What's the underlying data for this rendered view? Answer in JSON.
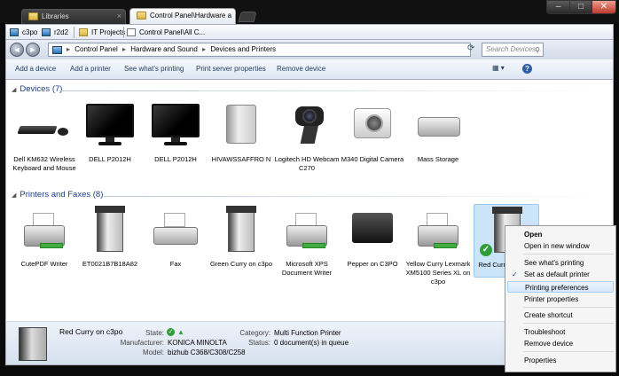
{
  "tabs": [
    {
      "label": "Libraries"
    },
    {
      "label": "Control Panel\\Hardware a"
    }
  ],
  "bookmarks": [
    {
      "label": "c3po",
      "icon": "computer-icon"
    },
    {
      "label": "r2d2",
      "icon": "computer-icon"
    },
    {
      "label": "IT Projects",
      "icon": "folder-icon"
    },
    {
      "label": "Control Panel\\All C...",
      "icon": "document-icon"
    }
  ],
  "address": {
    "crumbs": [
      "Control Panel",
      "Hardware and Sound",
      "Devices and Printers"
    ],
    "search_placeholder": "Search Devices..."
  },
  "commands": [
    "Add a device",
    "Add a printer",
    "See what's printing",
    "Print server properties",
    "Remove device"
  ],
  "groups": {
    "devices": {
      "label": "Devices (7)",
      "items": [
        "Dell KM632 Wireless Keyboard and Mouse",
        "DELL P2012H",
        "DELL P2012H",
        "HIVAWSSAFFRO N",
        "Logitech HD Webcam C270",
        "M340 Digital Camera",
        "Mass Storage"
      ]
    },
    "printers": {
      "label": "Printers and Faxes (8)",
      "items": [
        "CutePDF Writer",
        "ET0021B7B18A82",
        "Fax",
        "Green Curry on c3po",
        "Microsoft XPS Document Writer",
        "Pepper on C3PO",
        "Yellow Curry Lexmark XM5100 Series XL on c3po",
        "Red Curry on c3po"
      ]
    }
  },
  "details": {
    "name": "Red Curry on c3po",
    "state_label": "State:",
    "manufacturer_label": "Manufacturer:",
    "manufacturer": "KONICA MINOLTA",
    "model_label": "Model:",
    "model": "bizhub C368/C308/C258",
    "category_label": "Category:",
    "category": "Multi Function Printer",
    "status_label": "Status:",
    "status": "0 document(s) in queue"
  },
  "context_menu": [
    {
      "label": "Open",
      "bold": true
    },
    {
      "label": "Open in new window"
    },
    {
      "label": "See what's printing"
    },
    {
      "label": "Set as default printer",
      "checked": true
    },
    {
      "label": "Printing preferences",
      "highlighted": true
    },
    {
      "label": "Printer properties"
    },
    {
      "label": "Create shortcut"
    },
    {
      "label": "Troubleshoot"
    },
    {
      "label": "Remove device"
    },
    {
      "label": "Properties"
    }
  ]
}
